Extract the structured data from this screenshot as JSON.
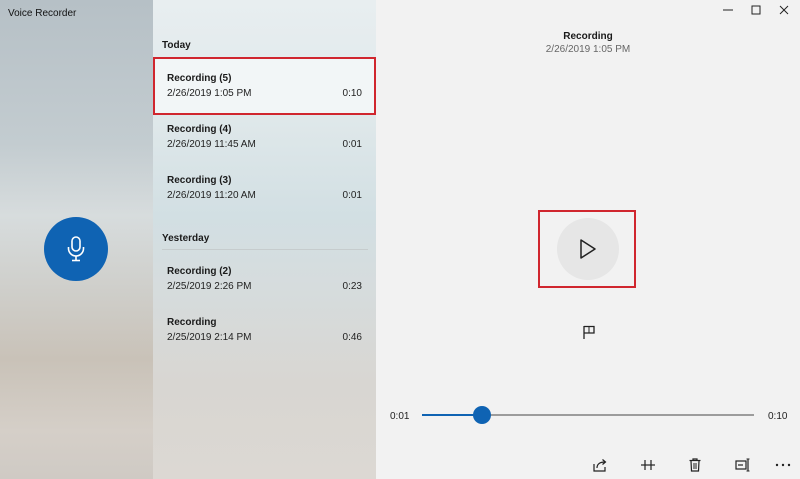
{
  "app": {
    "title": "Voice Recorder"
  },
  "groups": [
    {
      "label": "Today",
      "items": [
        {
          "name": "Recording (5)",
          "date": "2/26/2019 1:05 PM",
          "duration": "0:10",
          "selected": true
        },
        {
          "name": "Recording (4)",
          "date": "2/26/2019 11:45 AM",
          "duration": "0:01",
          "selected": false
        },
        {
          "name": "Recording (3)",
          "date": "2/26/2019 11:20 AM",
          "duration": "0:01",
          "selected": false
        }
      ]
    },
    {
      "label": "Yesterday",
      "items": [
        {
          "name": "Recording (2)",
          "date": "2/25/2019 2:26 PM",
          "duration": "0:23",
          "selected": false
        },
        {
          "name": "Recording",
          "date": "2/25/2019 2:14 PM",
          "duration": "0:46",
          "selected": false
        }
      ]
    }
  ],
  "playback": {
    "title": "Recording",
    "subtitle": "2/26/2019 1:05 PM",
    "current_time": "0:01",
    "total_time": "0:10",
    "progress": 0.18
  },
  "icons": {
    "record": "microphone-icon",
    "play": "play-icon",
    "marker": "flag-icon",
    "share": "share-icon",
    "trim": "trim-icon",
    "delete": "trash-icon",
    "rename": "rename-icon",
    "more": "more-icon"
  },
  "colors": {
    "accent": "#0f63b3",
    "highlight": "#d0262e"
  }
}
